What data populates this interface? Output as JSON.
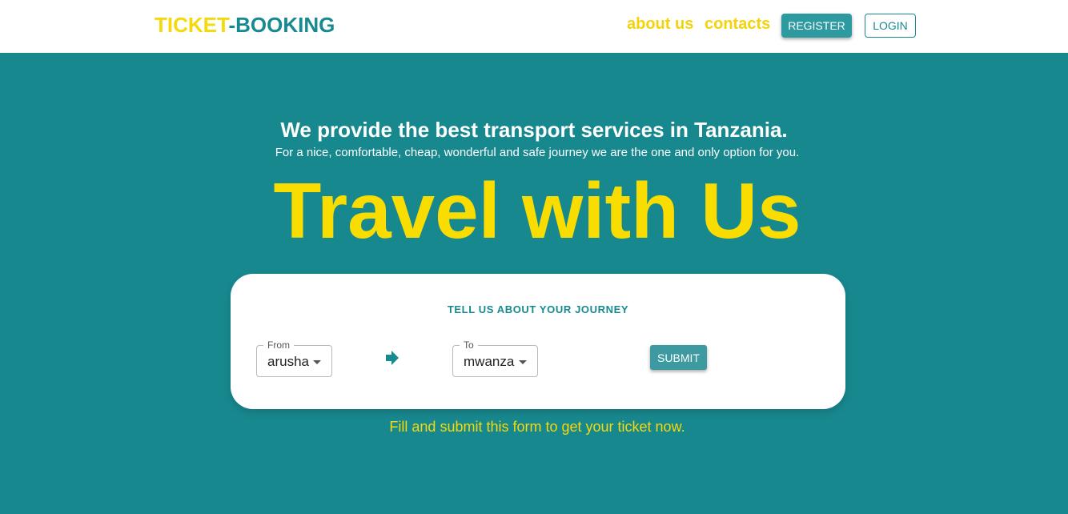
{
  "nav": {
    "logo_part1": "TICKET",
    "logo_part2": "-BOOKING",
    "about_label": "about us",
    "contacts_label": "contacts",
    "register_label": "REGISTER",
    "login_label": "LOGIN"
  },
  "hero": {
    "headline": "We provide the best transport services in Tanzania.",
    "subline": "For a nice, comfortable, cheap, wonderful and safe journey we are the one and only option for you.",
    "tagline": "Travel with Us"
  },
  "form": {
    "title": "TELL US ABOUT YOUR JOURNEY",
    "from_label": "From",
    "from_value": "arusha",
    "to_label": "To",
    "to_value": "mwanza",
    "submit_label": "SUBMIT",
    "hint": "Fill and submit this form to get your ticket now."
  },
  "icons": {
    "route_arrow": "arrow-right-icon",
    "dropdown": "chevron-down-icon"
  },
  "colors": {
    "brand_teal": "#18888f",
    "accent_yellow": "#f9dd00",
    "white": "#ffffff"
  }
}
